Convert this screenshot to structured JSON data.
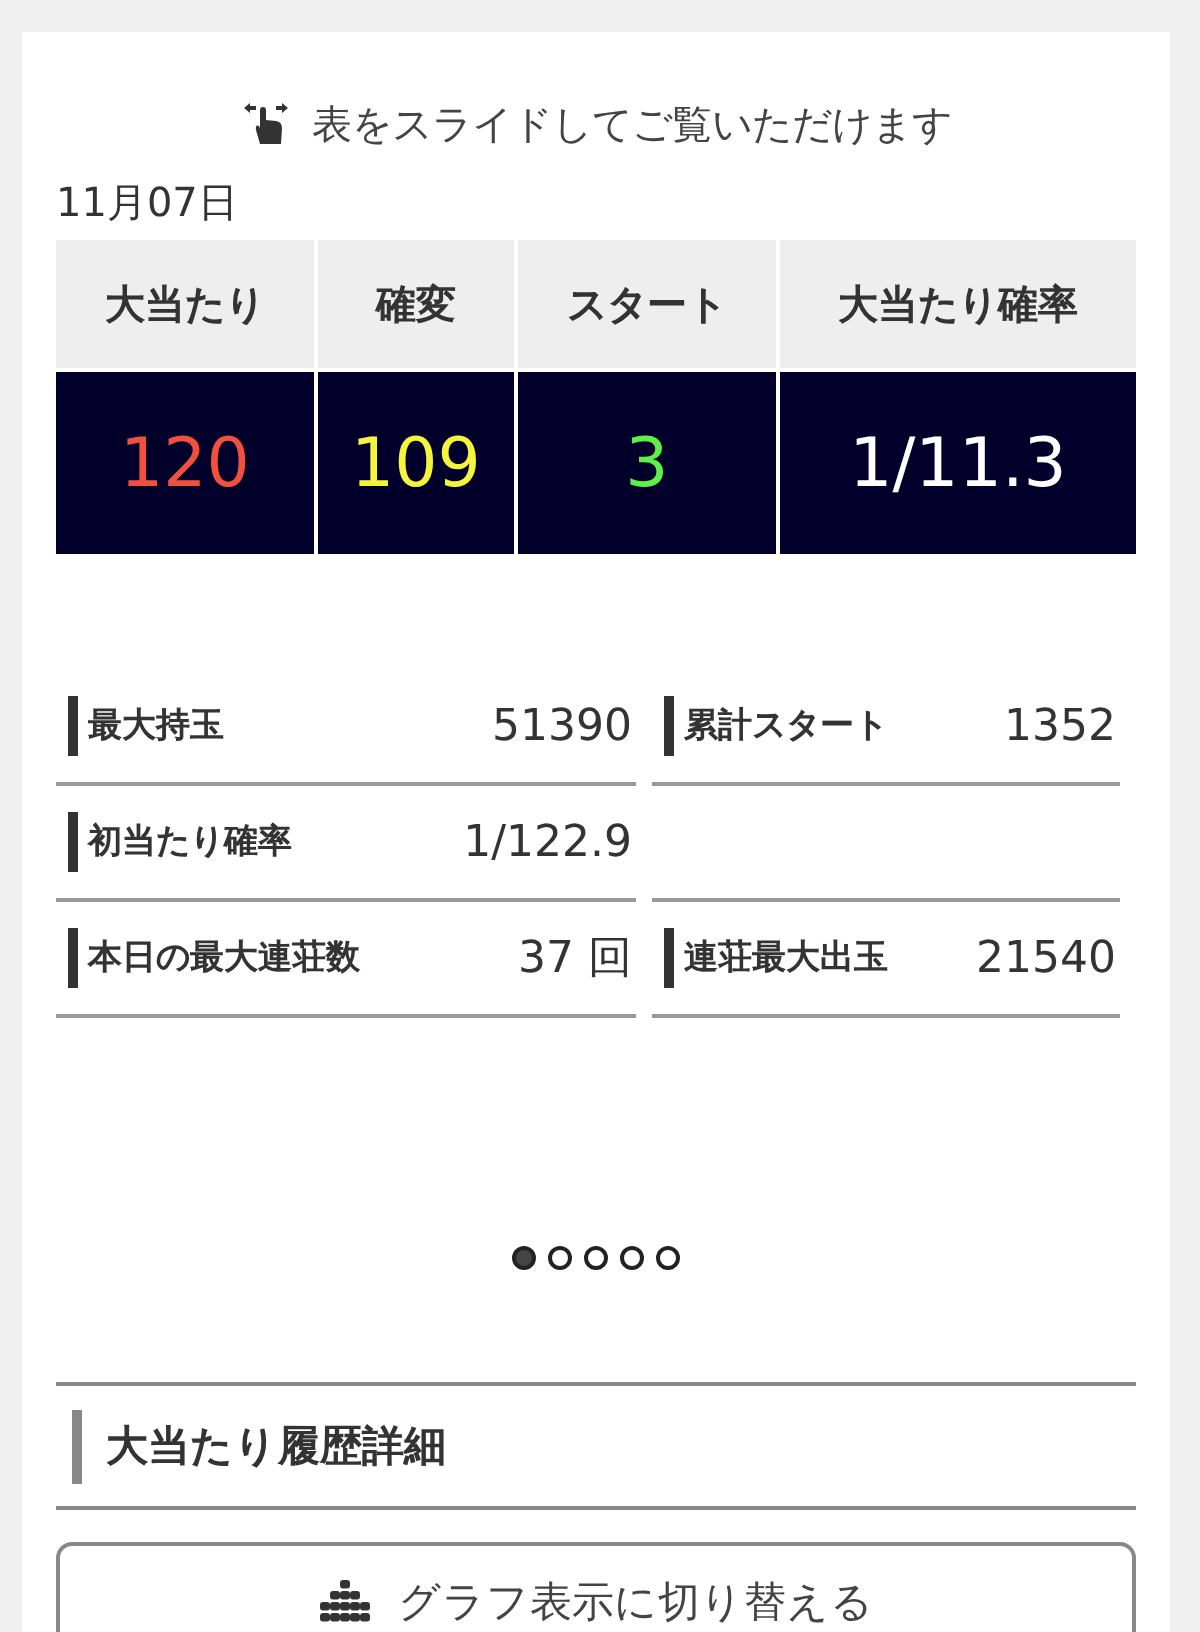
{
  "hint": "表をスライドしてご覧いただけます",
  "date": "11月07日",
  "table": {
    "columns": [
      "大当たり",
      "確変",
      "スタート",
      "大当たり確率"
    ],
    "values": [
      {
        "text": "120",
        "color": "#f2503f"
      },
      {
        "text": "109",
        "color": "#f4f43a"
      },
      {
        "text": "3",
        "color": "#5cf048"
      },
      {
        "text": "1/11.3",
        "color": "#ffffff"
      }
    ]
  },
  "stats": [
    {
      "kind": "stat",
      "label": "最大持玉",
      "value": "51390"
    },
    {
      "kind": "stat",
      "label": "累計スタート",
      "value": "1352"
    },
    {
      "kind": "stat",
      "label": "初当たり確率",
      "value": "1/122.9"
    },
    {
      "kind": "blank"
    },
    {
      "kind": "stat",
      "label": "本日の最大連荘数",
      "value": "37 回"
    },
    {
      "kind": "stat",
      "label": "連荘最大出玉",
      "value": "21540"
    }
  ],
  "pages": [
    {
      "selected": true
    },
    {
      "selected": false
    },
    {
      "selected": false
    },
    {
      "selected": false
    },
    {
      "selected": false
    }
  ],
  "section_title": "大当たり履歴詳細",
  "graph_button": "グラフ表示に切り替える"
}
